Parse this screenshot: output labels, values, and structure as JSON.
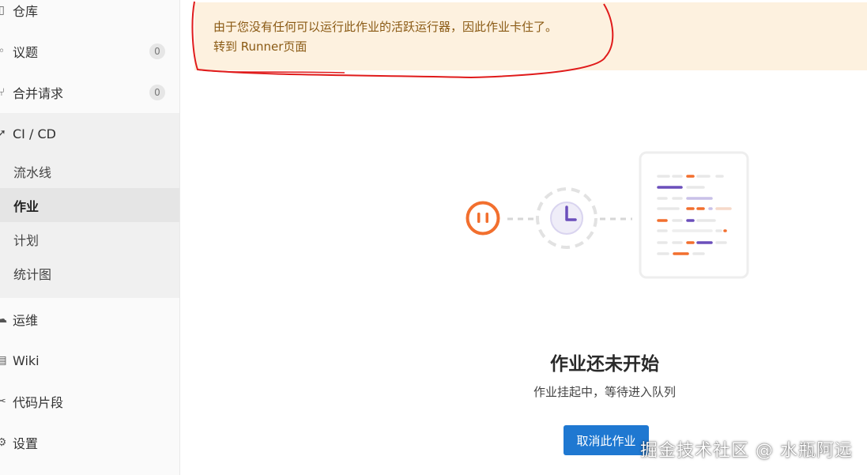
{
  "sidebar": {
    "items": [
      {
        "label": "仓库",
        "icon": "repository-icon"
      },
      {
        "label": "议题",
        "icon": "issues-icon",
        "badge": "0"
      },
      {
        "label": "合并请求",
        "icon": "merge-request-icon",
        "badge": "0"
      }
    ],
    "cicd": {
      "label": "CI / CD",
      "icon": "rocket-icon",
      "children": [
        {
          "label": "流水线"
        },
        {
          "label": "作业",
          "active": true
        },
        {
          "label": "计划"
        },
        {
          "label": "统计图"
        }
      ]
    },
    "bottom_items": [
      {
        "label": "运维",
        "icon": "cloud-icon"
      },
      {
        "label": "Wiki",
        "icon": "book-icon"
      },
      {
        "label": "代码片段",
        "icon": "snippet-icon"
      },
      {
        "label": "设置",
        "icon": "gear-icon"
      }
    ]
  },
  "alert": {
    "message": "由于您没有任何可以运行此作业的活跃运行器，因此作业卡住了。",
    "link": "转到 Runner页面"
  },
  "empty_state": {
    "title": "作业还未开始",
    "description": "作业挂起中，等待进入队列",
    "cancel_button": "取消此作业"
  },
  "watermark": "掘金技术社区 @ 水瓶阿远",
  "colors": {
    "accent": "#1f78d1",
    "alert_bg": "#fdf1df",
    "alert_text": "#8a5a14",
    "orange": "#f26f2e",
    "purple": "#6b4fbb"
  }
}
